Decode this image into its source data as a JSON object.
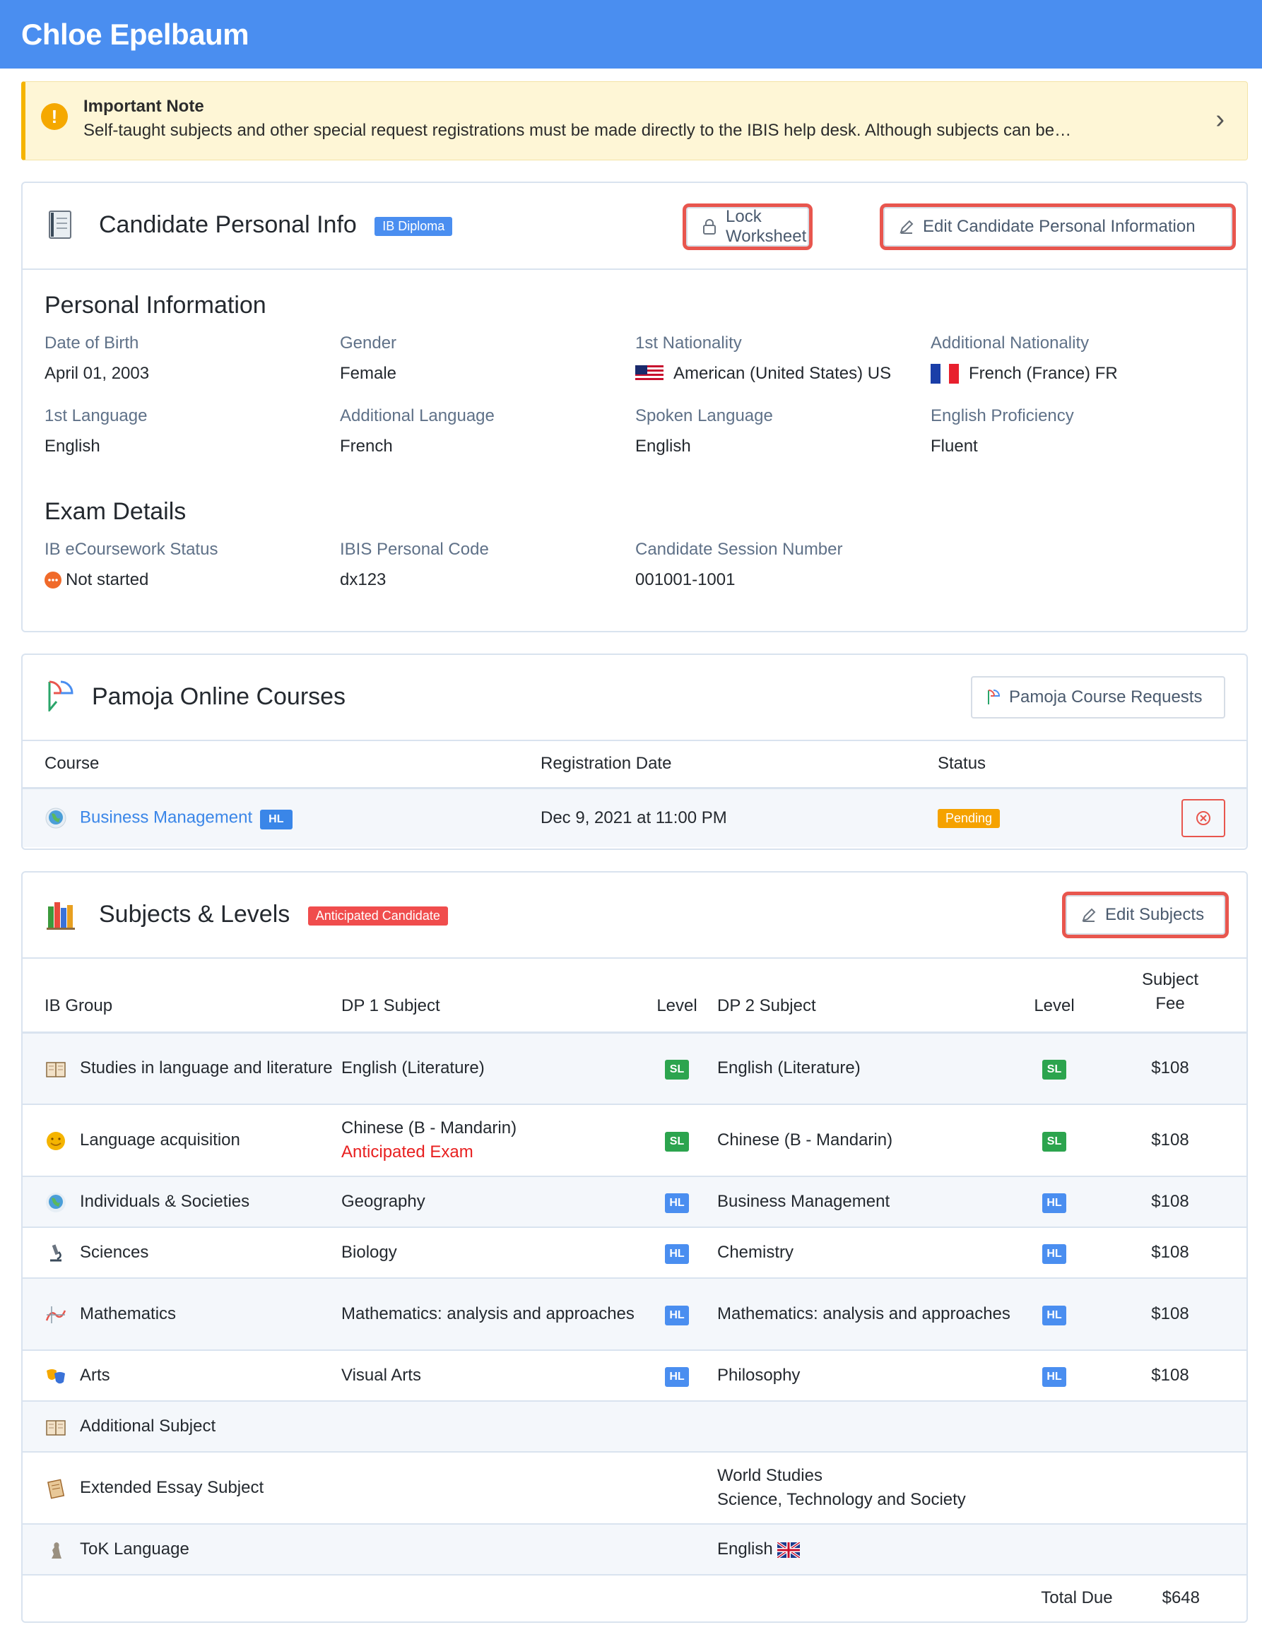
{
  "header": {
    "title": "Chloe Epelbaum"
  },
  "note": {
    "title": "Important Note",
    "text": "Self-taught subjects and other special request registrations must be made directly to the IBIS help desk. Although subjects can be…"
  },
  "personal": {
    "title": "Candidate Personal Info",
    "badge": "IB Diploma",
    "lock_label": "Lock Worksheet",
    "edit_label": "Edit Candidate Personal Information",
    "section1": "Personal Information",
    "fields": [
      {
        "label": "Date of Birth",
        "value": "April 01, 2003"
      },
      {
        "label": "Gender",
        "value": "Female"
      },
      {
        "label": "1st Nationality",
        "value": "American (United States) US"
      },
      {
        "label": "Additional Nationality",
        "value": "French (France) FR"
      },
      {
        "label": "1st Language",
        "value": "English"
      },
      {
        "label": "Additional Language",
        "value": "French"
      },
      {
        "label": "Spoken Language",
        "value": "English"
      },
      {
        "label": "English Proficiency",
        "value": "Fluent"
      }
    ],
    "section2": "Exam Details",
    "exam": [
      {
        "label": "IB eCoursework Status",
        "value": "Not started"
      },
      {
        "label": "IBIS Personal Code",
        "value": "dx123"
      },
      {
        "label": "Candidate Session Number",
        "value": "001001-1001"
      }
    ]
  },
  "pamoja": {
    "title": "Pamoja Online Courses",
    "request_label": "Pamoja Course Requests",
    "columns": [
      "Course",
      "Registration Date",
      "Status"
    ],
    "row": {
      "course": "Business Management",
      "level": "HL",
      "date": "Dec 9, 2021 at 11:00 PM",
      "status": "Pending"
    }
  },
  "subjects": {
    "title": "Subjects & Levels",
    "badge": "Anticipated Candidate",
    "edit_label": "Edit Subjects",
    "columns": [
      "IB Group",
      "DP 1 Subject",
      "Level",
      "DP 2 Subject",
      "Level",
      "Subject",
      "Fee"
    ],
    "rows": [
      {
        "group": "Studies in language and literature",
        "dp1": "English (Literature)",
        "dp1_note": "",
        "l1": "SL",
        "dp2": "English (Literature)",
        "l2": "SL",
        "fee": "$108",
        "icon": "book-icon"
      },
      {
        "group": "Language acquisition",
        "dp1": "Chinese (B - Mandarin)",
        "dp1_note": "Anticipated Exam",
        "l1": "SL",
        "dp2": "Chinese (B - Mandarin)",
        "l2": "SL",
        "fee": "$108",
        "icon": "speech-icon"
      },
      {
        "group": "Individuals & Societies",
        "dp1": "Geography",
        "dp1_note": "",
        "l1": "HL",
        "dp2": "Business Management",
        "l2": "HL",
        "fee": "$108",
        "icon": "globe-icon"
      },
      {
        "group": "Sciences",
        "dp1": "Biology",
        "dp1_note": "",
        "l1": "HL",
        "dp2": "Chemistry",
        "l2": "HL",
        "fee": "$108",
        "icon": "microscope-icon"
      },
      {
        "group": "Mathematics",
        "dp1": "Mathematics: analysis and approaches",
        "dp1_note": "",
        "l1": "HL",
        "dp2": "Mathematics: analysis and approaches",
        "l2": "HL",
        "fee": "$108",
        "icon": "graph-icon"
      },
      {
        "group": "Arts",
        "dp1": "Visual Arts",
        "dp1_note": "",
        "l1": "HL",
        "dp2": "Philosophy",
        "l2": "HL",
        "fee": "$108",
        "icon": "masks-icon"
      },
      {
        "group": "Additional Subject",
        "dp1": "",
        "dp1_note": "",
        "l1": "",
        "dp2": "",
        "l2": "",
        "fee": "",
        "icon": "book-icon"
      },
      {
        "group": "Extended Essay Subject",
        "dp1": "",
        "dp1_note": "",
        "l1": "",
        "dp2": "World Studies\nScience, Technology and Society",
        "l2": "",
        "fee": "",
        "icon": "scroll-icon"
      },
      {
        "group": "ToK Language",
        "dp1": "",
        "dp1_note": "",
        "l1": "",
        "dp2": "English",
        "l2": "",
        "fee": "",
        "icon": "thinker-icon"
      }
    ],
    "total_label": "Total Due",
    "total_value": "$648"
  },
  "colors": {
    "accent": "#4a8ef0",
    "highlight": "#e8564e",
    "warning": "#f5b400"
  }
}
